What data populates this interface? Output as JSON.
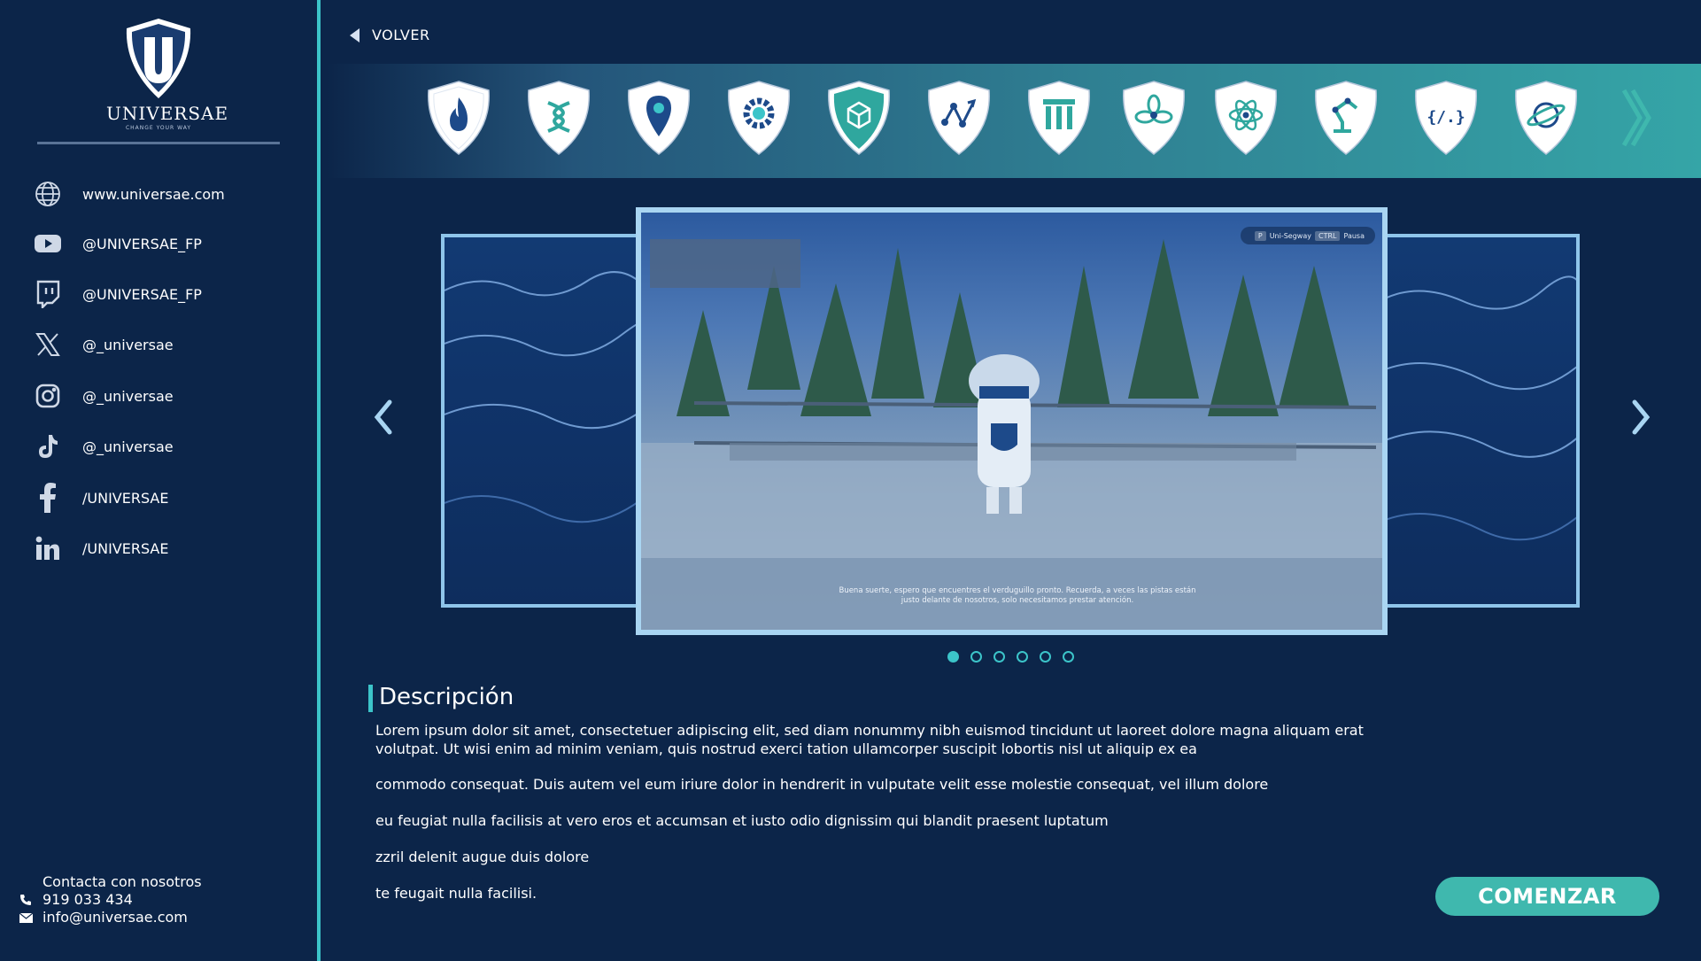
{
  "brand": {
    "name": "UNIVERSAE",
    "tagline": "CHANGE YOUR WAY"
  },
  "social": [
    {
      "icon": "globe-icon",
      "label": "www.universae.com"
    },
    {
      "icon": "youtube-icon",
      "label": "@UNIVERSAE_FP"
    },
    {
      "icon": "twitch-icon",
      "label": "@UNIVERSAE_FP"
    },
    {
      "icon": "x-icon",
      "label": "@_universae"
    },
    {
      "icon": "instagram-icon",
      "label": "@_universae"
    },
    {
      "icon": "tiktok-icon",
      "label": "@_universae"
    },
    {
      "icon": "facebook-icon",
      "label": "/UNIVERSAE"
    },
    {
      "icon": "linkedin-icon",
      "label": "/UNIVERSAE"
    }
  ],
  "contact": {
    "title": "Contacta con nosotros",
    "phone": "919 033 434",
    "email": "info@universae.com"
  },
  "nav": {
    "back_label": "VOLVER"
  },
  "categories": [
    "flame-icon",
    "dna-icon",
    "location-pin-icon",
    "gear-wrench-icon",
    "cube-icon",
    "network-graph-icon",
    "columns-icon",
    "flower-icon",
    "atom-icon",
    "robot-arm-icon",
    "code-icon",
    "planet-icon"
  ],
  "carousel": {
    "hud": {
      "key1": "P",
      "action1": "Uni-Segway",
      "key2": "CTRL",
      "action2": "Pausa"
    },
    "subtitle": "Buena suerte, espero que encuentres el verduguillo pronto. Recuerda, a veces las pistas están justo delante de nosotros, solo necesitamos prestar atención.",
    "slide_count": 6,
    "active_index": 0
  },
  "description": {
    "title": "Descripción",
    "paragraphs": [
      "Lorem ipsum dolor sit amet, consectetuer adipiscing elit, sed diam nonummy nibh euismod tincidunt ut laoreet dolore magna aliquam erat volutpat. Ut wisi enim ad minim veniam, quis nostrud exerci tation ullamcorper suscipit lobortis nisl ut aliquip ex ea",
      "commodo consequat. Duis autem vel eum iriure dolor in hendrerit in vulputate velit esse molestie consequat, vel illum dolore",
      " eu feugiat nulla facilisis at vero eros et accumsan et iusto odio dignissim qui blandit praesent luptatum",
      "zzril delenit augue duis dolore",
      "te feugait nulla facilisi."
    ]
  },
  "actions": {
    "start_label": "COMENZAR"
  },
  "colors": {
    "background": "#0c2549",
    "accent": "#3cc4c9",
    "button": "#3fb8ae",
    "shield": "#1d4a8a"
  }
}
